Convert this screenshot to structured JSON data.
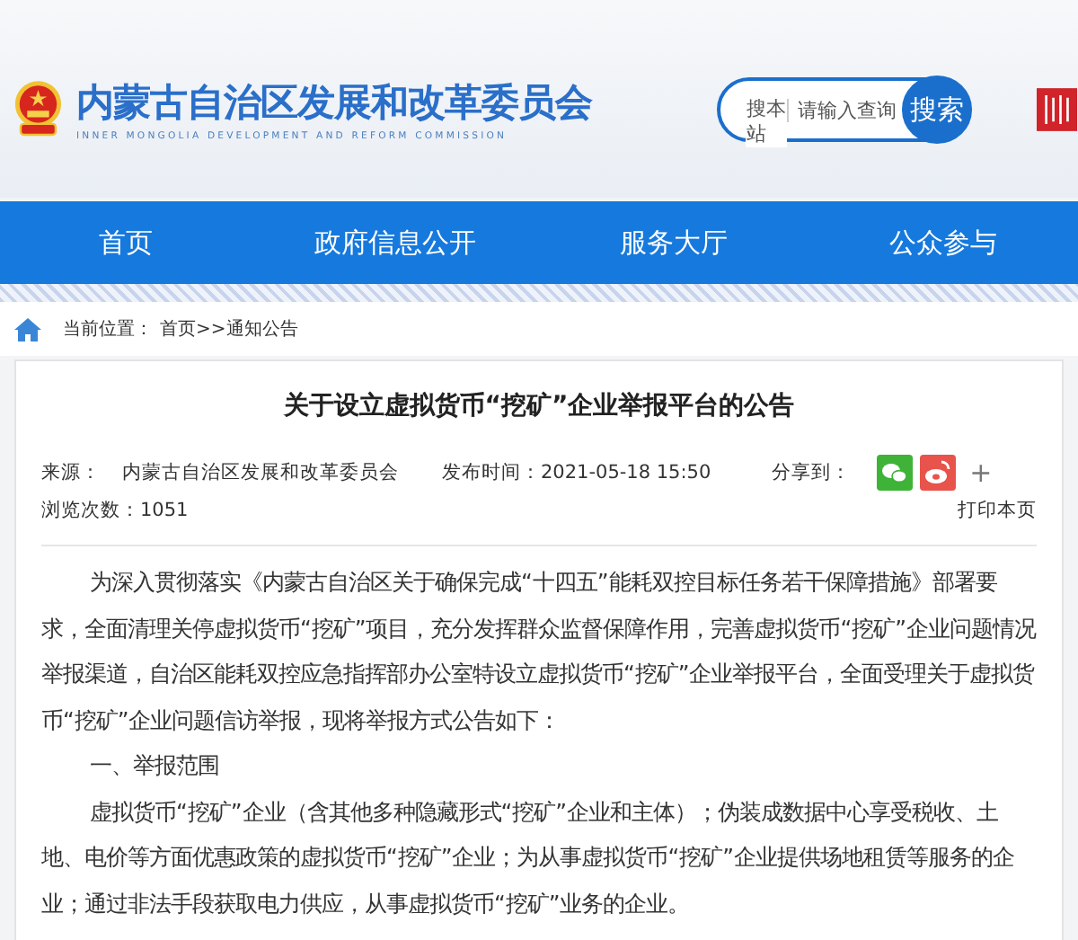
{
  "header": {
    "title": "内蒙古自治区发展和改革委员会",
    "subtitle": "INNER MONGOLIA DEVELOPMENT AND REFORM COMMISSION",
    "search": {
      "scope": "搜本站",
      "placeholder": "请输入查询",
      "button": "搜索"
    }
  },
  "nav": [
    {
      "label": "首页",
      "selected": false
    },
    {
      "label": "政府信息公开",
      "selected": false
    },
    {
      "label": "服务大厅",
      "selected": false
    },
    {
      "label": "公众参与",
      "selected": false
    }
  ],
  "breadcrumb": {
    "label": "当前位置：",
    "path": "首页>>通知公告"
  },
  "article": {
    "title": "关于设立虚拟货币“挖矿”企业举报平台的公告",
    "source_label": "来源：",
    "source": "内蒙古自治区发展和改革委员会",
    "time_label": "发布时间：",
    "time": "2021-05-18 15:50",
    "share_label": "分享到：",
    "share_more": "+",
    "views": "浏览次数：1051",
    "print": "打印本页",
    "paragraphs": [
      {
        "text": "为深入贯彻落实《内蒙古自治区关于确保完成“十四五”能耗双控目标任务若干保障措施》部署要求，全面清理关停虚拟货币“挖矿”项目，充分发挥群众监督保障作用，完善虚拟货币“挖矿”企业问题情况举报渠道，自治区能耗双控应急指挥部办公室特设立虚拟货币“挖矿”企业举报平台，全面受理关于虚拟货币“挖矿”企业问题信访举报，现将举报方式公告如下："
      },
      {
        "text": "一、举报范围"
      },
      {
        "text": "虚拟货币“挖矿”企业（含其他多种隐藏形式“挖矿”企业和主体）；伪装成数据中心享受税收、土地、电价等方面优惠政策的虚拟货币“挖矿”企业；为从事虚拟货币“挖矿”企业提供场地租赁等服务的企业；通过非法手段获取电力供应，从事虚拟货币“挖矿”业务的企业。"
      }
    ]
  }
}
